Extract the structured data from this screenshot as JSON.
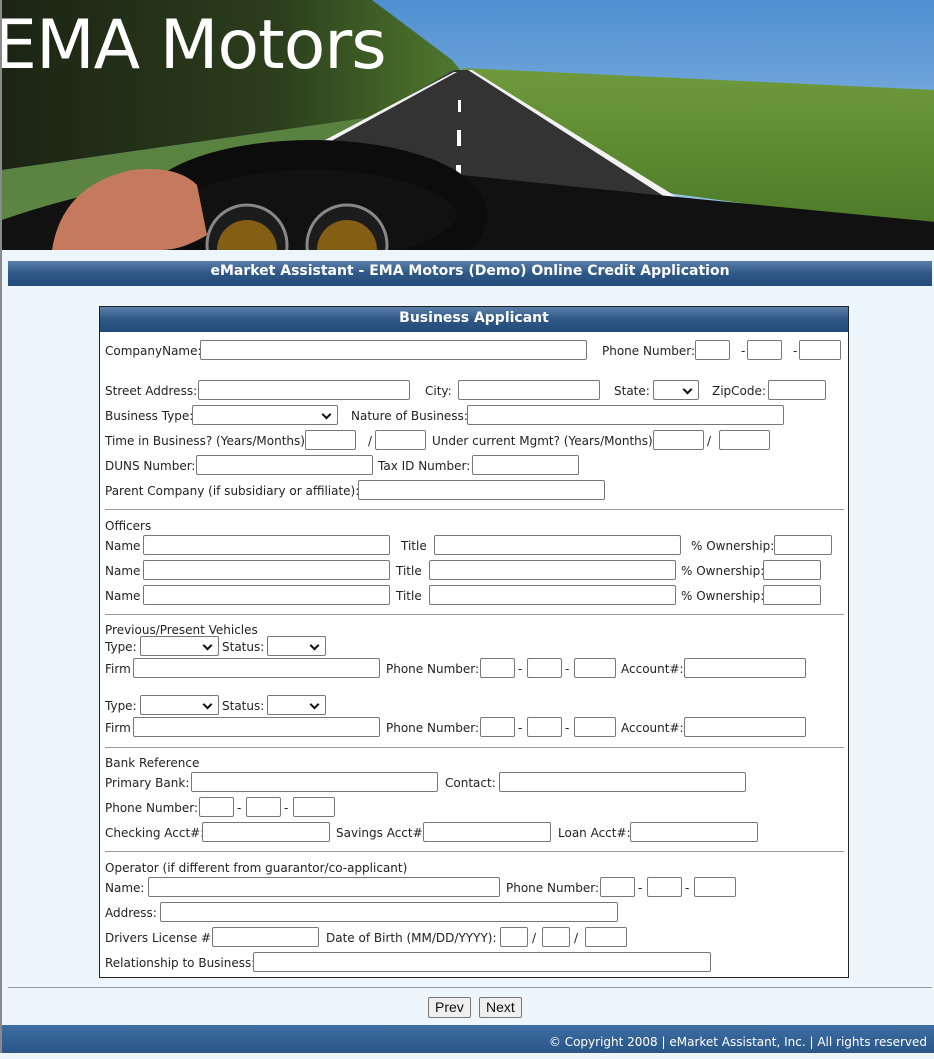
{
  "banner": {
    "brand": "EMA Motors",
    "image_alt": "car-dashboard-highway-image"
  },
  "page_title": "eMarket Assistant - EMA Motors (Demo) Online Credit Application",
  "section_title": "Business Applicant",
  "company": {
    "company_name_label": "CompanyName:",
    "phone_label": "Phone Number:",
    "phone_sep": "-",
    "street_label": "Street Address:",
    "city_label": "City:",
    "state_label": "State:",
    "state_value": "",
    "zip_label": "ZipCode:",
    "business_type_label": "Business Type:",
    "business_type_value": "",
    "nature_label": "Nature of Business:",
    "time_in_business_label": "Time in Business? (Years/Months):",
    "slash": "/",
    "mgmt_label": "Under current Mgmt? (Years/Months):",
    "duns_label": "DUNS Number:",
    "taxid_label": "Tax ID Number:",
    "parent_label": "Parent Company (if subsidiary or affiliate):"
  },
  "officers": {
    "heading": "Officers",
    "rows": [
      {
        "name_label": "Name",
        "title_label": "Title",
        "ownership_label": "% Ownership:"
      },
      {
        "name_label": "Name",
        "title_label": "Title",
        "ownership_label": "% Ownership:"
      },
      {
        "name_label": "Name",
        "title_label": "Title",
        "ownership_label": "% Ownership:"
      }
    ]
  },
  "vehicles": {
    "heading": "Previous/Present Vehicles",
    "entries": [
      {
        "type_label": "Type:",
        "type_value": "",
        "status_label": "Status:",
        "status_value": "",
        "firm_label": "Firm",
        "phone_label": "Phone Number:",
        "account_label": "Account#:"
      },
      {
        "type_label": "Type:",
        "type_value": "",
        "status_label": "Status:",
        "status_value": "",
        "firm_label": "Firm",
        "phone_label": "Phone Number:",
        "account_label": "Account#:"
      }
    ],
    "phone_sep": "-"
  },
  "bank": {
    "heading": "Bank Reference",
    "primary_label": "Primary Bank:",
    "contact_label": "Contact:",
    "phone_label": "Phone Number:",
    "phone_sep": "-",
    "checking_label": "Checking Acct#:",
    "savings_label": "Savings Acct#:",
    "loan_label": "Loan Acct#:"
  },
  "operator": {
    "heading": "Operator (if different from guarantor/co-applicant)",
    "name_label": "Name:",
    "phone_label": "Phone Number:",
    "phone_sep": "-",
    "address_label": "Address:",
    "license_label": "Drivers License #:",
    "dob_label": "Date of Birth (MM/DD/YYYY):",
    "dob_sep": "/",
    "relationship_label": "Relationship to Business:"
  },
  "nav": {
    "prev_label": "Prev",
    "next_label": "Next"
  },
  "footer": {
    "text": "© Copyright 2008 | eMarket Assistant, Inc. | All rights reserved"
  }
}
